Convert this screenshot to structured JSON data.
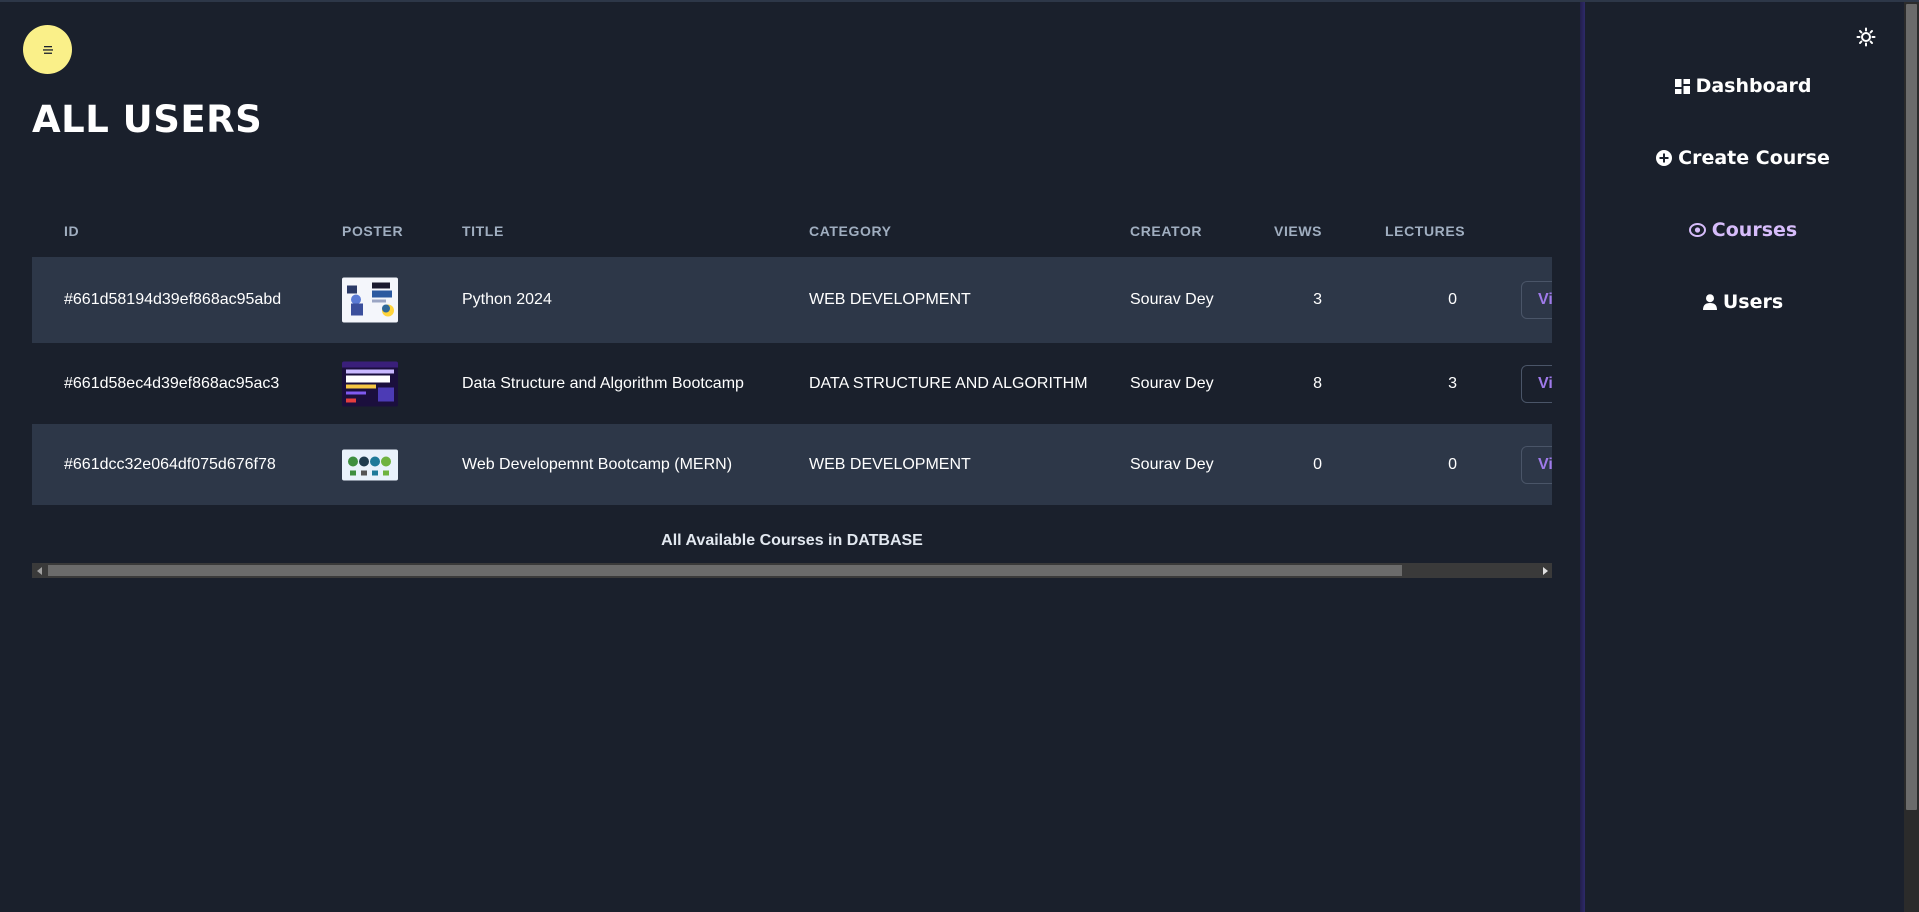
{
  "page": {
    "title": "ALL USERS",
    "menu_icon": "menu-lines-icon",
    "accent_menu_color": "#faf089",
    "background_color": "#1a202c"
  },
  "table": {
    "columns": [
      "ID",
      "POSTER",
      "TITLE",
      "CATEGORY",
      "CREATOR",
      "VIEWS",
      "LECTURES"
    ],
    "rows": [
      {
        "id": "#661d58194d39ef868ac95abd",
        "poster": "python-poster-image",
        "title": "Python 2024",
        "category": "WEB DEVELOPMENT",
        "creator": "Sourav Dey",
        "views": "3",
        "lectures": "0",
        "action_label": "Vi"
      },
      {
        "id": "#661d58ec4d39ef868ac95ac3",
        "poster": "dsa-poster-image",
        "title": "Data Structure and Algorithm Bootcamp",
        "category": "DATA STRUCTURE AND ALGORITHM",
        "creator": "Sourav Dey",
        "views": "8",
        "lectures": "3",
        "action_label": "Vi"
      },
      {
        "id": "#661dcc32e064df075d676f78",
        "poster": "mern-poster-image",
        "title": "Web Developemnt Bootcamp (MERN)",
        "category": "WEB DEVELOPMENT",
        "creator": "Sourav Dey",
        "views": "0",
        "lectures": "0",
        "action_label": "Vi"
      }
    ],
    "caption": "All Available Courses in DATBASE",
    "row_shade_color": "#2d3748",
    "action_color": "#9f7aea"
  },
  "sidebar": {
    "theme_toggle_icon": "sun-icon",
    "items": [
      {
        "label": "Dashboard",
        "icon": "dashboard-grid-icon"
      },
      {
        "label": "Create Course",
        "icon": "plus-circle-icon"
      },
      {
        "label": "Courses",
        "icon": "eye-icon",
        "active": true
      },
      {
        "label": "Users",
        "icon": "user-icon"
      }
    ],
    "active_color": "#d6bcfa"
  }
}
